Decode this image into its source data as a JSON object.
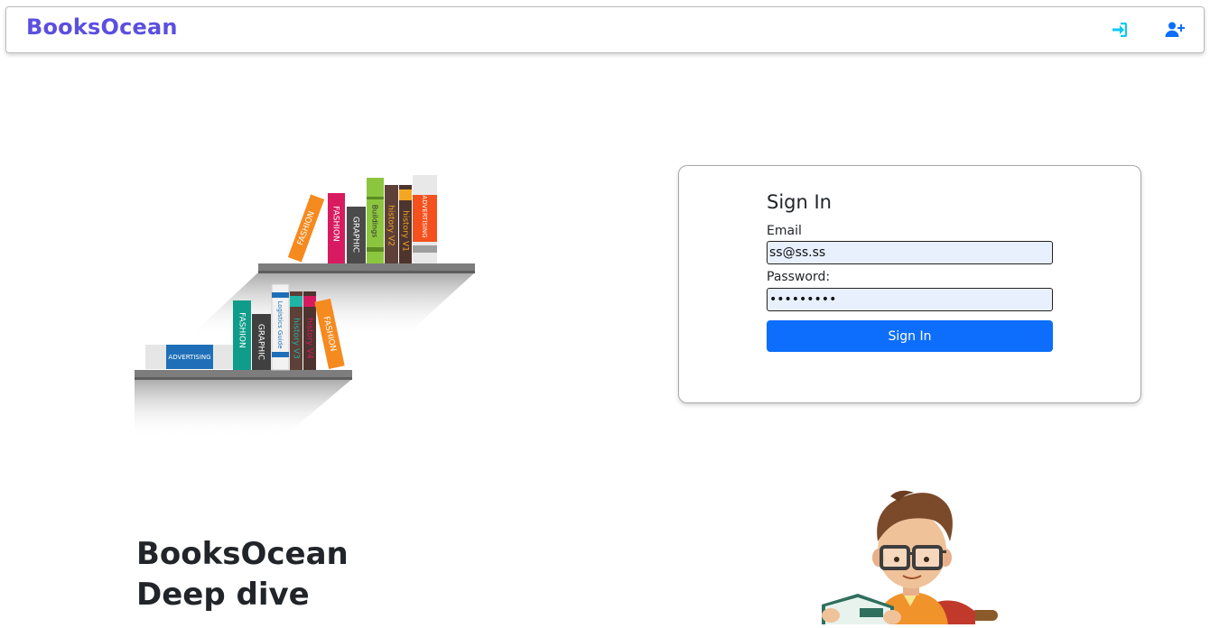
{
  "nav": {
    "brand": "BooksOcean",
    "login_icon": "sign-in-icon",
    "register_icon": "user-plus-icon",
    "colors": {
      "brand": "#5b4fe0",
      "login": "#0dcaf0",
      "register": "#0d6efd"
    }
  },
  "shelf_books": {
    "top": [
      "FASHION",
      "FASHION",
      "GRAPHIC",
      "Buildings",
      "history V2",
      "history V1",
      "ADVERTISING"
    ],
    "bottom": [
      "ADVERTISING",
      "FASHION",
      "GRAPHIC",
      "Logistics Guide",
      "history V3",
      "history V4",
      "FASHION"
    ]
  },
  "login": {
    "title": "Sign In",
    "email_label": "Email",
    "email_value": "ss@ss.ss",
    "password_label": "Password:",
    "password_value": "123456789",
    "submit_label": "Sign In",
    "button_color": "#0d6efd"
  },
  "hero": {
    "line1": "BooksOcean",
    "line2": "Deep dive"
  }
}
